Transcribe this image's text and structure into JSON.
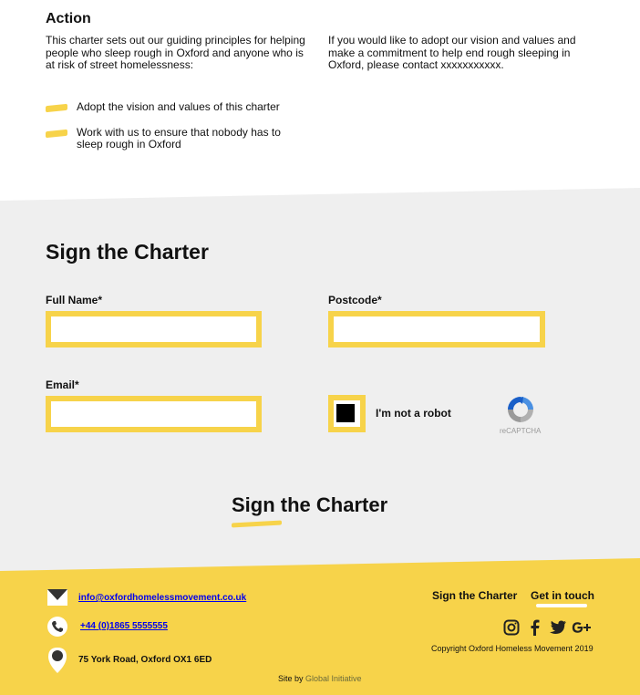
{
  "action": {
    "heading": "Action",
    "intro_left": "This charter sets out our guiding principles for helping people who sleep rough in Oxford and anyone who is at risk of street homelessness:",
    "intro_right": "If you would like to adopt our vision and values and make a commitment to help end rough sleeping in Oxford, please contact xxxxxxxxxxx.",
    "bullets": [
      "Adopt the vision and values of this charter",
      "Work with us to ensure that nobody has to sleep rough in Oxford"
    ]
  },
  "form": {
    "heading": "Sign the Charter",
    "full_name_label": "Full Name*",
    "full_name_value": "",
    "postcode_label": "Postcode*",
    "postcode_value": "",
    "email_label": "Email*",
    "email_value": "",
    "captcha_label": "I'm not a robot",
    "captcha_brand": "reCAPTCHA",
    "submit_label": "Sign the Charter"
  },
  "footer": {
    "email": "info@oxfordhomelessmovement.co.uk",
    "phone": "+44 (0)1865 5555555",
    "address": "75 York Road, Oxford OX1 6ED",
    "nav": [
      "Sign the Charter",
      "Get in touch"
    ],
    "social_icons": [
      "instagram-icon",
      "facebook-icon",
      "twitter-icon",
      "google-plus-icon"
    ],
    "copyright": "Copyright Oxford Homeless Movement 2019",
    "credit_prefix": "Site by",
    "credit_link": "Global Initiative"
  },
  "colors": {
    "accent": "#f7d34a",
    "grey_band": "#efefef",
    "text": "#111111"
  }
}
